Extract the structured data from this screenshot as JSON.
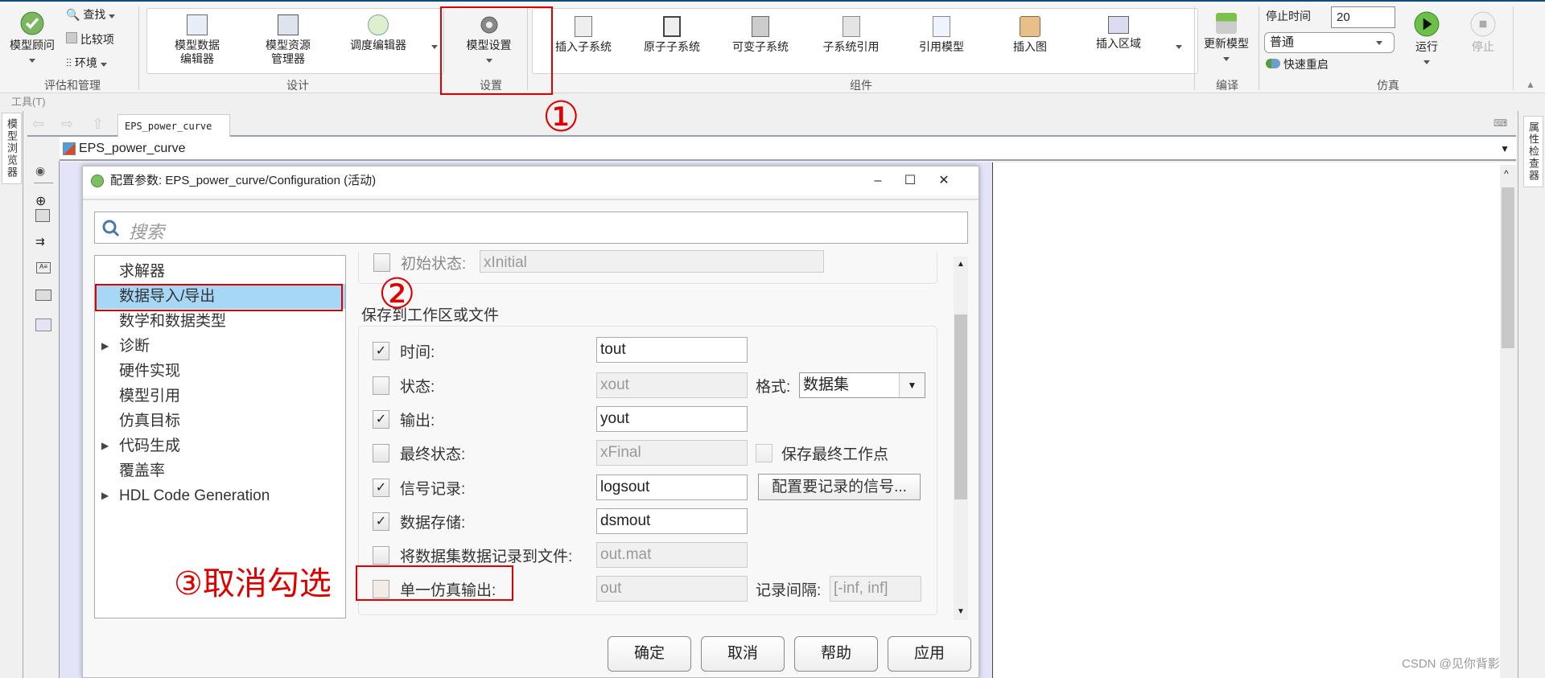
{
  "ribbon": {
    "groups": [
      {
        "label": "评估和管理"
      },
      {
        "label": "设计"
      },
      {
        "label": "设置"
      },
      {
        "label": "组件"
      },
      {
        "label": "编译"
      },
      {
        "label": "仿真"
      }
    ],
    "model_advisor": "模型顾问",
    "find": "查找",
    "compare": "比较项",
    "environment": "环境",
    "design_buttons": [
      {
        "line1": "模型数据",
        "line2": "编辑器",
        "icon": "data-editor-icon"
      },
      {
        "line1": "模型资源",
        "line2": "管理器",
        "icon": "resource-manager-icon"
      },
      {
        "line1": "调度编辑器",
        "line2": "",
        "icon": "schedule-editor-icon"
      }
    ],
    "model_settings": "模型设置",
    "component_buttons": [
      {
        "label": "插入子系统",
        "icon": "subsystem-icon"
      },
      {
        "label": "原子子系统",
        "icon": "atomic-subsystem-icon"
      },
      {
        "label": "可变子系统",
        "icon": "variant-subsystem-icon"
      },
      {
        "label": "子系统引用",
        "icon": "subsystem-reference-icon"
      },
      {
        "label": "引用模型",
        "icon": "model-reference-icon"
      },
      {
        "label": "插入图",
        "icon": "insert-chart-icon"
      },
      {
        "label": "插入区域",
        "icon": "insert-area-icon"
      }
    ],
    "update_model": "更新模型",
    "stop_time_label": "停止时间",
    "stop_time_value": "20",
    "sim_mode": "普通",
    "fast_restart": "快速重启",
    "run": "运行",
    "stop": "停止"
  },
  "menu": {
    "tools": "工具(T)"
  },
  "left_tab": "模型浏览器",
  "right_tab": "属性检查器",
  "doc_tab": "EPS_power_curve",
  "address": "EPS_power_curve",
  "dialog": {
    "title": "配置参数: EPS_power_curve/Configuration (活动)",
    "minimize": "–",
    "maximize": "☐",
    "close": "✕",
    "search_placeholder": "搜索",
    "tree": [
      {
        "label": "求解器",
        "expandable": false,
        "selected": false
      },
      {
        "label": "数据导入/导出",
        "expandable": false,
        "selected": true
      },
      {
        "label": "数学和数据类型",
        "expandable": false,
        "selected": false
      },
      {
        "label": "诊断",
        "expandable": true,
        "selected": false
      },
      {
        "label": "硬件实现",
        "expandable": false,
        "selected": false
      },
      {
        "label": "模型引用",
        "expandable": false,
        "selected": false
      },
      {
        "label": "仿真目标",
        "expandable": false,
        "selected": false
      },
      {
        "label": "代码生成",
        "expandable": true,
        "selected": false
      },
      {
        "label": "覆盖率",
        "expandable": false,
        "selected": false
      },
      {
        "label": "HDL Code Generation",
        "expandable": true,
        "selected": false
      }
    ],
    "initial_state": {
      "label": "初始状态:",
      "value": "xInitial",
      "checked": false
    },
    "section_title": "保存到工作区或文件",
    "fields": [
      {
        "label": "时间:",
        "value": "tout",
        "checked": true,
        "enabled": true
      },
      {
        "label": "状态:",
        "value": "xout",
        "checked": false,
        "enabled": false
      },
      {
        "label": "输出:",
        "value": "yout",
        "checked": true,
        "enabled": true
      },
      {
        "label": "最终状态:",
        "value": "xFinal",
        "checked": false,
        "enabled": false
      },
      {
        "label": "信号记录:",
        "value": "logsout",
        "checked": true,
        "enabled": true
      },
      {
        "label": "数据存储:",
        "value": "dsmout",
        "checked": true,
        "enabled": true
      },
      {
        "label": "将数据集数据记录到文件:",
        "value": "out.mat",
        "checked": false,
        "enabled": false
      },
      {
        "label": "单一仿真输出:",
        "value": "out",
        "checked": false,
        "enabled": false
      }
    ],
    "format_label": "格式:",
    "format_value": "数据集",
    "save_final_op": "保存最终工作点",
    "config_signals_button": "配置要记录的信号...",
    "log_interval_label": "记录间隔:",
    "log_interval_value": "[-inf, inf]",
    "buttons": {
      "ok": "确定",
      "cancel": "取消",
      "help": "帮助",
      "apply": "应用"
    }
  },
  "annotations": {
    "step1": "①",
    "step2": "②",
    "step3": "③取消勾选"
  },
  "watermark": "CSDN @见你背影"
}
